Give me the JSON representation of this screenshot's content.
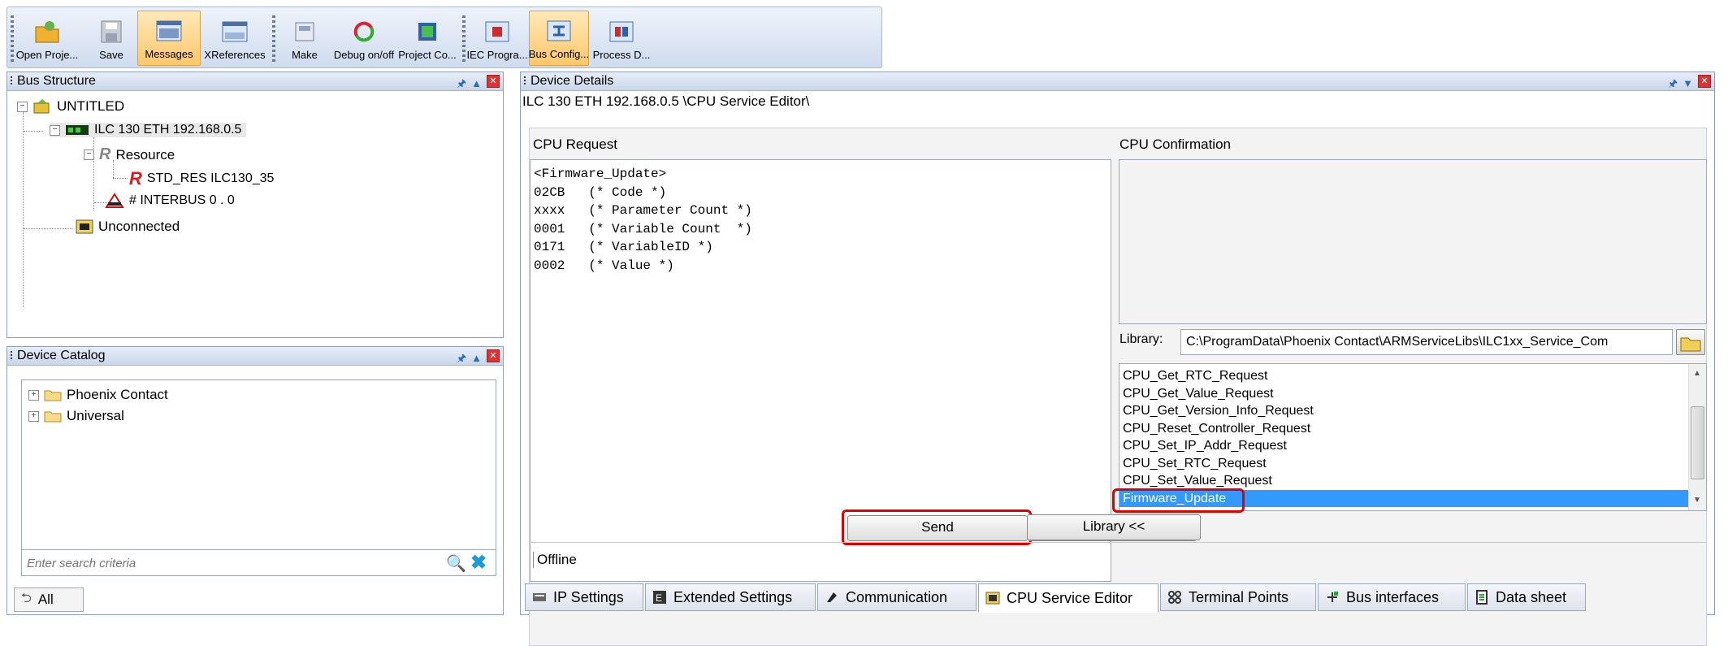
{
  "toolbar": {
    "buttons": [
      {
        "label": "Open Proje..."
      },
      {
        "label": "Save"
      },
      {
        "label": "Messages"
      },
      {
        "label": "XReferences"
      },
      {
        "label": "Make"
      },
      {
        "label": "Debug on/off"
      },
      {
        "label": "Project Co..."
      },
      {
        "label": "IEC Progra..."
      },
      {
        "label": "Bus Config..."
      },
      {
        "label": "Process D..."
      }
    ]
  },
  "bus_structure": {
    "title": "Bus Structure",
    "nodes": [
      {
        "label": "UNTITLED"
      },
      {
        "label": "ILC 130 ETH 192.168.0.5"
      },
      {
        "label": "Resource"
      },
      {
        "label": "STD_RES ILC130_35"
      },
      {
        "label": "# INTERBUS 0 . 0"
      },
      {
        "label": "Unconnected"
      }
    ]
  },
  "device_catalog": {
    "title": "Device Catalog",
    "items": [
      {
        "label": "Phoenix Contact"
      },
      {
        "label": "Universal"
      }
    ],
    "search_placeholder": "Enter search criteria",
    "filter_label": "All"
  },
  "device_details": {
    "title": "Device Details",
    "breadcrumb": "ILC 130 ETH 192.168.0.5 \\CPU Service Editor\\",
    "cpu_request_label": "CPU Request",
    "cpu_request_lines": [
      "<Firmware_Update>",
      "02CB   (* Code *)",
      "xxxx   (* Parameter Count *)",
      "0001   (* Variable Count  *)",
      "0171   (* VariableID *)",
      "0002   (* Value *)"
    ],
    "cpu_confirmation_label": "CPU Confirmation",
    "library_label": "Library:",
    "library_path": "C:\\ProgramData\\Phoenix Contact\\ARMServiceLibs\\ILC1xx_Service_Com",
    "library_items": [
      "CPU_Get_RTC_Request",
      "CPU_Get_Value_Request",
      "CPU_Get_Version_Info_Request",
      "CPU_Reset_Controller_Request",
      "CPU_Set_IP_Addr_Request",
      "CPU_Set_RTC_Request",
      "CPU_Set_Value_Request",
      "Firmware_Update"
    ],
    "selected_library_item": "Firmware_Update",
    "send_label": "Send",
    "library_toggle_label": "Library <<",
    "status": "Offline"
  },
  "tabs": [
    {
      "label": "IP Settings"
    },
    {
      "label": "Extended Settings"
    },
    {
      "label": "Communication"
    },
    {
      "label": "CPU Service Editor"
    },
    {
      "label": "Terminal Points"
    },
    {
      "label": "Bus interfaces"
    },
    {
      "label": "Data sheet"
    }
  ],
  "active_tab": "CPU Service Editor",
  "colors": {
    "highlight_red": "#e00000",
    "selection_blue": "#3399ff",
    "toolbar_active": "#ffc76a"
  }
}
